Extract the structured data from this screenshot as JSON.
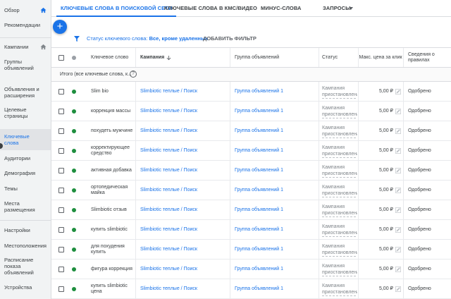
{
  "sidebar": {
    "items": [
      {
        "label": "Обзор",
        "home": true
      },
      {
        "label": "Рекомендации"
      },
      {
        "label": "Кампании",
        "home": true
      },
      {
        "label": "Группы объявлений"
      },
      {
        "label": "Объявления и расширения"
      },
      {
        "label": "Целевые страницы"
      },
      {
        "label": "Ключевые слова",
        "active": true
      },
      {
        "label": "Аудитории"
      },
      {
        "label": "Демография"
      },
      {
        "label": "Темы"
      },
      {
        "label": "Места размещения"
      },
      {
        "label": "Настройки"
      },
      {
        "label": "Местоположения"
      },
      {
        "label": "Расписание показа объявлений"
      },
      {
        "label": "Устройства"
      }
    ]
  },
  "tabs": [
    {
      "label": "КЛЮЧЕВЫЕ СЛОВА В ПОИСКОВОЙ СЕТИ",
      "active": true
    },
    {
      "label": "КЛЮЧЕВЫЕ СЛОВА В КМС/ВИДЕО"
    },
    {
      "label": "МИНУС-СЛОВА"
    },
    {
      "label": "ЗАПРОСЫ"
    }
  ],
  "fab_label": "+",
  "filter": {
    "prefix": "Статус ключевого слова: ",
    "value": "Все, кроме удаленных",
    "add_label": "ДОБАВИТЬ ФИЛЬТР"
  },
  "table": {
    "headers": {
      "keyword": "Ключевое слово",
      "campaign": "Кампания",
      "adgroup": "Группа объявлений",
      "status": "Статус",
      "maxcpc": "Макс. цена за клик",
      "policy": "Сведения о правилах"
    },
    "totals_label": "Итого (все ключевые слова, к...",
    "help_glyph": "?",
    "rows": [
      {
        "keyword": "Slim bio",
        "campaign": "Slimbiotic теплые / Поиск",
        "adgroup": "Группа объявлений 1",
        "status": "Кампания приостановлена",
        "price": "5,00 ₽",
        "policy": "Одобрено"
      },
      {
        "keyword": "коррекция массы",
        "campaign": "Slimbiotic теплые / Поиск",
        "adgroup": "Группа объявлений 1",
        "status": "Кампания приостановлена",
        "price": "5,00 ₽",
        "policy": "Одобрено"
      },
      {
        "keyword": "похудеть мужчине",
        "campaign": "Slimbiotic теплые / Поиск",
        "adgroup": "Группа объявлений 1",
        "status": "Кампания приостановлена",
        "price": "5,00 ₽",
        "policy": "Одобрено"
      },
      {
        "keyword": "корректирующее средство",
        "campaign": "Slimbiotic теплые / Поиск",
        "adgroup": "Группа объявлений 1",
        "status": "Кампания приостановлена",
        "price": "5,00 ₽",
        "policy": "Одобрено"
      },
      {
        "keyword": "активная добавка",
        "campaign": "Slimbiotic теплые / Поиск",
        "adgroup": "Группа объявлений 1",
        "status": "Кампания приостановлена",
        "price": "5,00 ₽",
        "policy": "Одобрено"
      },
      {
        "keyword": "ортопедическая майка",
        "campaign": "Slimbiotic теплые / Поиск",
        "adgroup": "Группа объявлений 1",
        "status": "Кампания приостановлена",
        "price": "5,00 ₽",
        "policy": "Одобрено"
      },
      {
        "keyword": "Slimbiotic отзыв",
        "campaign": "Slimbiotic теплые / Поиск",
        "adgroup": "Группа объявлений 1",
        "status": "Кампания приостановлена",
        "price": "5,00 ₽",
        "policy": "Одобрено"
      },
      {
        "keyword": "купить slimbiotic",
        "campaign": "Slimbiotic теплые / Поиск",
        "adgroup": "Группа объявлений 1",
        "status": "Кампания приостановлена",
        "price": "5,00 ₽",
        "policy": "Одобрено"
      },
      {
        "keyword": "для похудения купить",
        "campaign": "Slimbiotic теплые / Поиск",
        "adgroup": "Группа объявлений 1",
        "status": "Кампания приостановлена",
        "price": "5,00 ₽",
        "policy": "Одобрено"
      },
      {
        "keyword": "фигура коррекция",
        "campaign": "Slimbiotic теплые / Поиск",
        "adgroup": "Группа объявлений 1",
        "status": "Кампания приостановлена",
        "price": "5,00 ₽",
        "policy": "Одобрено"
      },
      {
        "keyword": "купить slimbiotic цена",
        "campaign": "Slimbiotic теплые / Поиск",
        "adgroup": "Группа объявлений 1",
        "status": "Кампания приостановлена",
        "price": "5,00 ₽",
        "policy": "Одобрено"
      }
    ]
  },
  "colors": {
    "accent": "#1a73e8",
    "enabled_dot": "#1e8e3e",
    "sidebar_bg": "#f1f3f4"
  }
}
